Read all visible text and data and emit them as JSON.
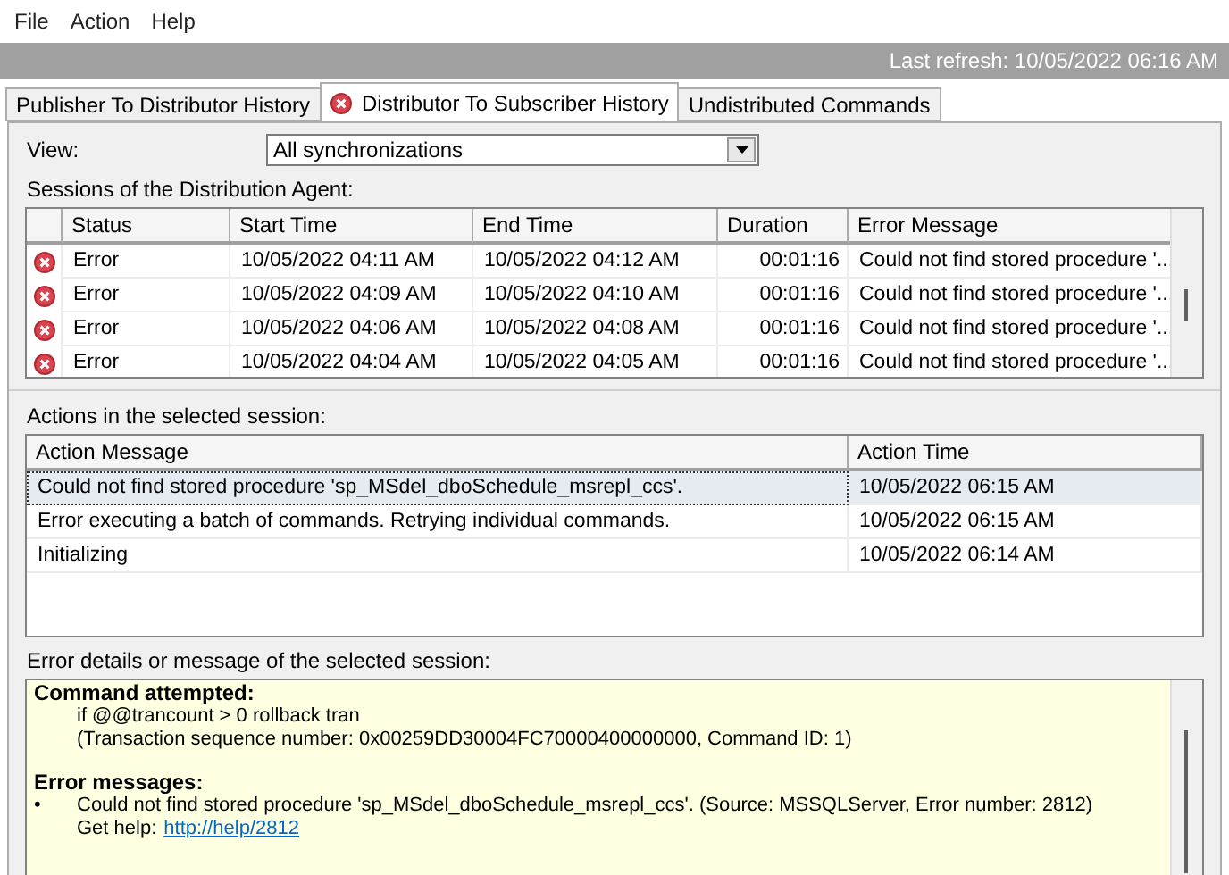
{
  "menu": [
    "File",
    "Action",
    "Help"
  ],
  "status_bar": {
    "last_refresh": "Last refresh: 10/05/2022 06:16 AM"
  },
  "tabs": [
    {
      "label": "Publisher To Distributor History",
      "selected": false,
      "error": false
    },
    {
      "label": "Distributor To Subscriber History",
      "selected": true,
      "error": true
    },
    {
      "label": "Undistributed Commands",
      "selected": false,
      "error": false
    }
  ],
  "view": {
    "label": "View:",
    "value": "All synchronizations"
  },
  "sessions": {
    "label": "Sessions of the Distribution Agent:",
    "columns": [
      "Status",
      "Start Time",
      "End Time",
      "Duration",
      "Error Message"
    ],
    "rows": [
      {
        "kind": "error",
        "status": "Error",
        "start": "10/05/2022 04:11 AM",
        "end": "10/05/2022 04:12 AM",
        "duration": "00:01:16",
        "message": "Could not find stored procedure '..."
      },
      {
        "kind": "error",
        "status": "Error",
        "start": "10/05/2022 04:09 AM",
        "end": "10/05/2022 04:10 AM",
        "duration": "00:01:16",
        "message": "Could not find stored procedure '..."
      },
      {
        "kind": "error",
        "status": "Error",
        "start": "10/05/2022 04:06 AM",
        "end": "10/05/2022 04:08 AM",
        "duration": "00:01:16",
        "message": "Could not find stored procedure '..."
      },
      {
        "kind": "error",
        "status": "Error",
        "start": "10/05/2022 04:04 AM",
        "end": "10/05/2022 04:05 AM",
        "duration": "00:01:16",
        "message": "Could not find stored procedure '..."
      }
    ]
  },
  "actions": {
    "label": "Actions in the selected session:",
    "columns": [
      "Action Message",
      "Action Time"
    ],
    "rows": [
      {
        "message": "Could not find stored procedure 'sp_MSdel_dboSchedule_msrepl_ccs'.",
        "time": "10/05/2022 06:15 AM",
        "selected": true
      },
      {
        "message": "Error executing a batch of commands. Retrying individual commands.",
        "time": "10/05/2022 06:15 AM",
        "selected": false
      },
      {
        "message": "Initializing",
        "time": "10/05/2022 06:14 AM",
        "selected": false
      }
    ]
  },
  "details": {
    "label": "Error details or message of the selected session:",
    "command": {
      "heading": "Command attempted:",
      "lines": [
        "if @@trancount > 0 rollback tran",
        "(Transaction sequence number: 0x00259DD30004FC70000400000000, Command ID: 1)"
      ]
    },
    "errors": {
      "heading": "Error messages:",
      "items": [
        {
          "bullet": "•",
          "text": "Could not find stored procedure 'sp_MSdel_dboSchedule_msrepl_ccs'. (Source: MSSQLServer, Error number: 2812)",
          "help_label": "Get help:",
          "help_link": "http://help/2812"
        }
      ]
    }
  }
}
